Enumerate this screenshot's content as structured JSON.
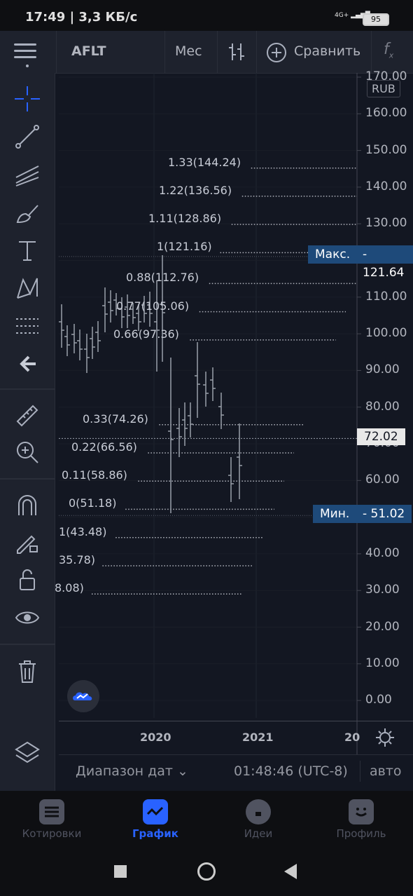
{
  "status_bar": {
    "time": "17:49",
    "speed": "3,3 КБ/с",
    "network": "4G+",
    "battery": "95"
  },
  "toolbar": {
    "symbol": "AFLT",
    "interval": "Мес",
    "compare_label": "Сравнить",
    "fx_label": "f"
  },
  "chart": {
    "currency": "RUB",
    "price_axis": [
      "170.00",
      "160.00",
      "150.00",
      "140.00",
      "130.00",
      "120.00",
      "110.00",
      "100.00",
      "90.00",
      "80.00",
      "70.00",
      "60.00",
      "50.00",
      "40.00",
      "30.00",
      "20.00",
      "10.00",
      "0.00"
    ],
    "time_axis": [
      "2020",
      "2021",
      "20"
    ],
    "current_price": "72.02",
    "max_label": "Макс.",
    "max_value": "121.64",
    "min_label": "Мин.",
    "min_value": "51.02",
    "fib_levels": [
      "1.33(144.24)",
      "1.22(136.56)",
      "1.11(128.86)",
      "1(121.16)",
      "0.88(112.76)",
      "0.77(105.06)",
      "0.66(97.36)",
      "0.33(74.26)",
      "0.22(66.56)",
      "0.11(58.86)",
      "0(51.18)",
      "1(43.48)",
      "35.78)",
      "8.08)"
    ]
  },
  "range_bar": {
    "date_range": "Диапазон дат",
    "clock": "01:48:46 (UTC-8)",
    "scale_mode": "авто"
  },
  "bottom_nav": [
    {
      "label": "Котировки",
      "icon": "list-icon"
    },
    {
      "label": "График",
      "icon": "chart-icon"
    },
    {
      "label": "Идеи",
      "icon": "bulb-icon"
    },
    {
      "label": "Профиль",
      "icon": "profile-icon"
    }
  ],
  "colors": {
    "background": "#131722",
    "panel": "#1e222d",
    "accent": "#2962ff",
    "tag_blue": "#1e4a7a"
  }
}
